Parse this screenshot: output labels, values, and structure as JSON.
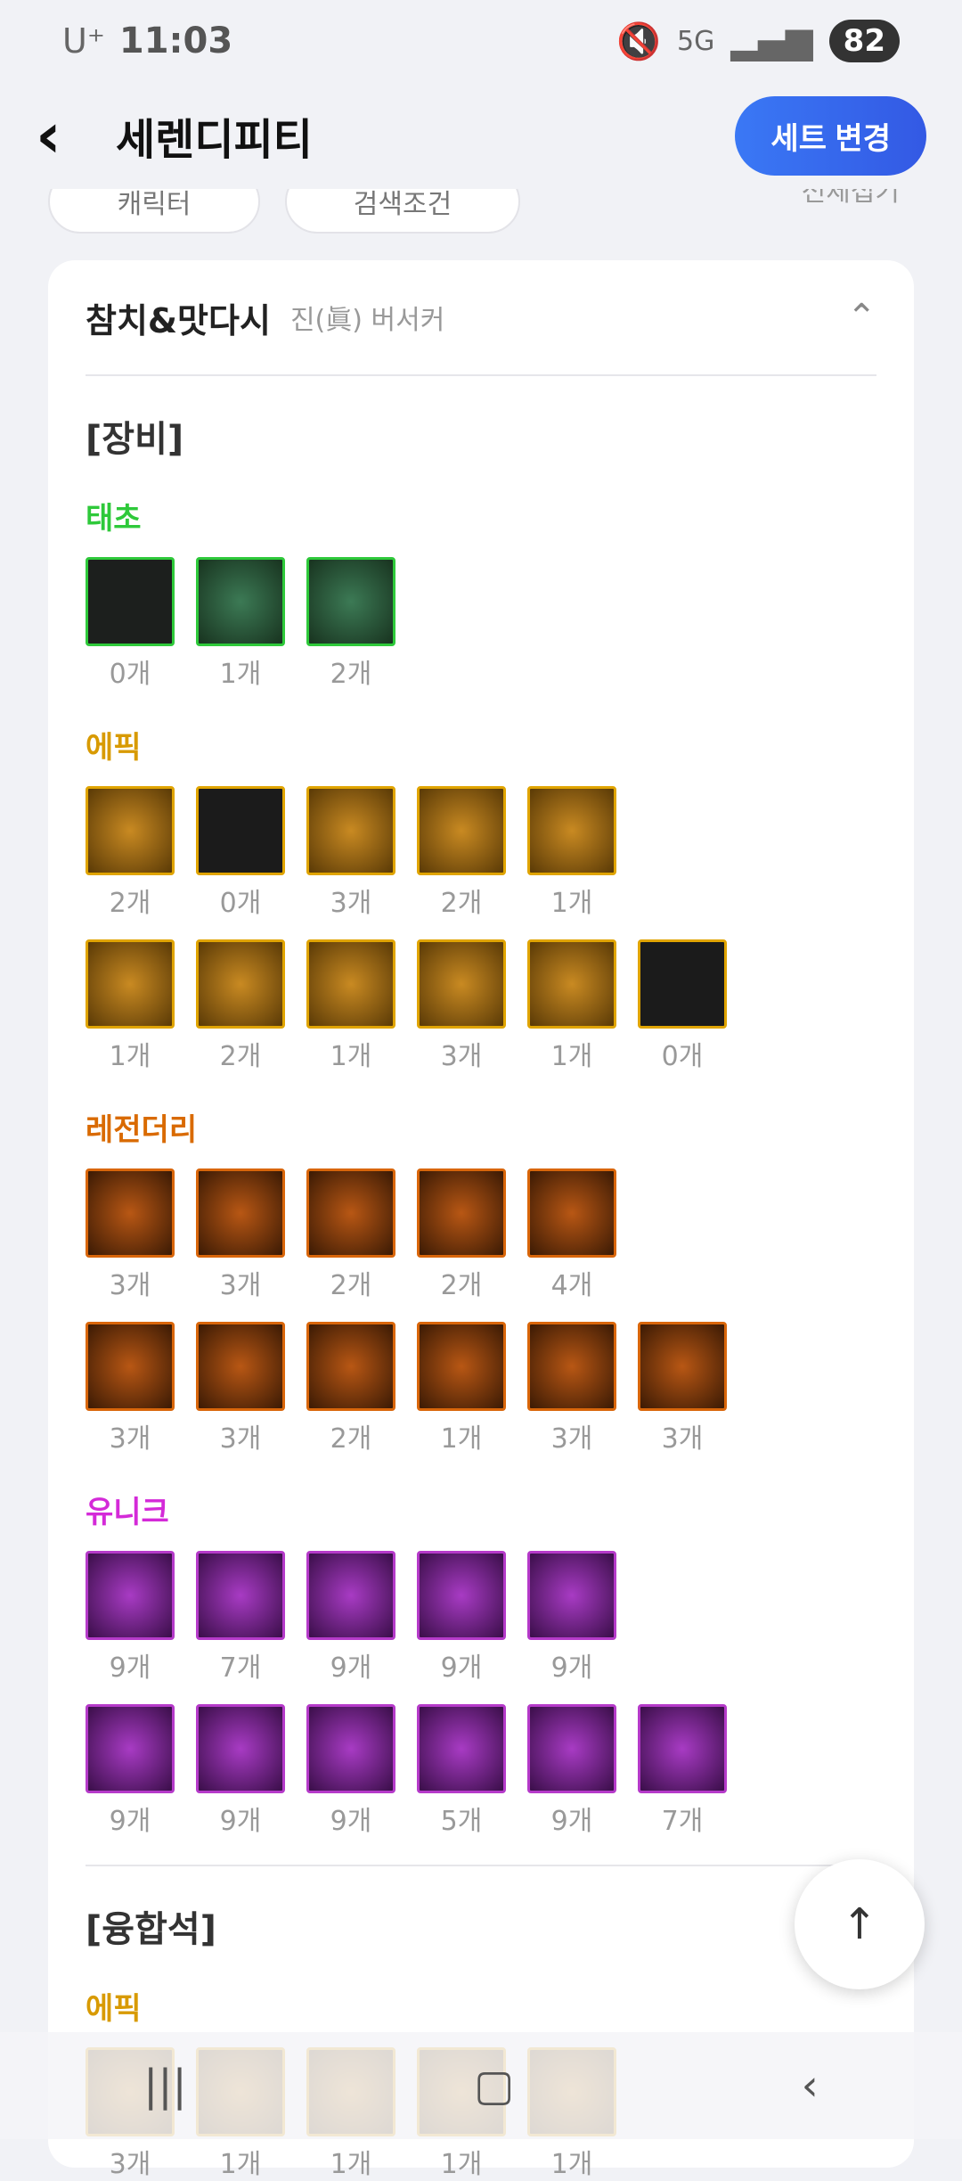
{
  "status": {
    "carrier": "U⁺",
    "time": "11:03",
    "network": "5G",
    "battery": "82"
  },
  "header": {
    "title": "세렌디피티",
    "set_button": "세트 변경"
  },
  "filters": {
    "chip1": "캐릭터",
    "chip2": "검색조건",
    "collapse_all": "전체접기"
  },
  "character": {
    "name": "참치&맛다시",
    "job": "진(眞) 버서커"
  },
  "sections": {
    "equipment": "[장비]",
    "fusion": "[융합석]"
  },
  "grades": {
    "taecho": "태초",
    "epic": "에픽",
    "legendary": "레전더리",
    "unique": "유니크"
  },
  "equipment": {
    "taecho": [
      [
        "0개"
      ],
      [
        "1개",
        "2개"
      ]
    ],
    "taecho_counts": [
      "0개",
      "1개",
      "2개"
    ],
    "epic_row1": [
      "2개",
      "0개",
      "3개",
      "2개",
      "1개"
    ],
    "epic_row2": [
      "1개",
      "2개",
      "1개",
      "3개",
      "1개",
      "0개"
    ],
    "legend_row1": [
      "3개",
      "3개",
      "2개",
      "2개",
      "4개"
    ],
    "legend_row2": [
      "3개",
      "3개",
      "2개",
      "1개",
      "3개",
      "3개"
    ],
    "unique_row1": [
      "9개",
      "7개",
      "9개",
      "9개",
      "9개"
    ],
    "unique_row2": [
      "9개",
      "9개",
      "9개",
      "5개",
      "9개",
      "7개"
    ]
  },
  "fusion": {
    "epic_row1": [
      "3개",
      "1개",
      "1개",
      "1개",
      "1개"
    ]
  },
  "icons": {
    "back": "back-arrow-icon",
    "collapse": "chevron-up-icon",
    "scroll_top": "arrow-up-icon"
  }
}
